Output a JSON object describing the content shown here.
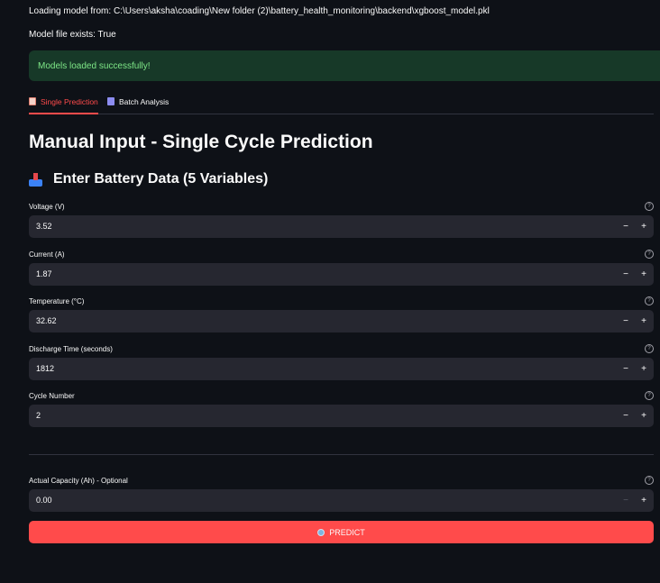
{
  "log": {
    "loading": "Loading model from: C:\\Users\\aksha\\coading\\New folder (2)\\battery_health_monitoring\\backend\\xgboost_model.pkl",
    "exists": "Model file exists: True"
  },
  "alert": {
    "text": "Models loaded successfully!",
    "color": "#173928"
  },
  "tabs": [
    {
      "label": "Single Prediction",
      "icon": "document-icon",
      "active": true
    },
    {
      "label": "Batch Analysis",
      "icon": "database-icon",
      "active": false
    }
  ],
  "header": {
    "title": "Manual Input - Single Cycle Prediction"
  },
  "section": {
    "title": "Enter Battery Data (5 Variables)",
    "icon": "inbox-tray-icon"
  },
  "fields": [
    {
      "label": "Voltage (V)",
      "value": "3.52"
    },
    {
      "label": "Current (A)",
      "value": "1.87"
    },
    {
      "label": "Temperature (°C)",
      "value": "32.62"
    },
    {
      "label": "Discharge Time (seconds)",
      "value": "1812"
    },
    {
      "label": "Cycle Number",
      "value": "2"
    }
  ],
  "optional_field": {
    "label": "Actual Capacity (Ah) - Optional",
    "value": "0.00"
  },
  "stepper": {
    "minus": "−",
    "plus": "+"
  },
  "help_glyph": "?",
  "predict_button": {
    "label": "PREDICT",
    "icon": "magnifier-icon",
    "color": "#ff4b4b"
  },
  "colors": {
    "background": "#0e1117",
    "input": "#262730",
    "accent": "#ff4b4b",
    "success_text": "#7ee787"
  }
}
